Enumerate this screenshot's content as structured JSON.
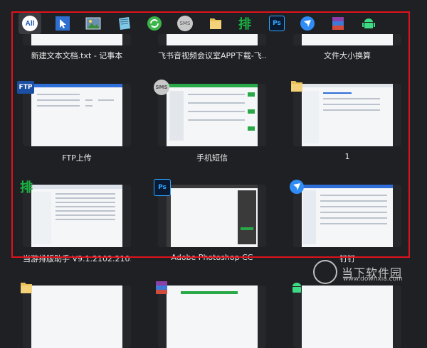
{
  "filter_bar": {
    "items": [
      {
        "name": "all",
        "label": "All"
      },
      {
        "name": "cursor",
        "label": ""
      },
      {
        "name": "photo-viewer",
        "label": ""
      },
      {
        "name": "notepad",
        "label": ""
      },
      {
        "name": "refresh",
        "label": ""
      },
      {
        "name": "sms",
        "label": "SMS"
      },
      {
        "name": "folder",
        "label": ""
      },
      {
        "name": "paiban",
        "label": "排"
      },
      {
        "name": "photoshop",
        "label": "Ps"
      },
      {
        "name": "dingtalk",
        "label": ""
      },
      {
        "name": "winrar",
        "label": ""
      },
      {
        "name": "android",
        "label": ""
      }
    ]
  },
  "windows": [
    {
      "caption": "新建文本文档.txt - 记事本"
    },
    {
      "caption": "飞书音视频会议室APP下载-飞..."
    },
    {
      "caption": "文件大小换算"
    },
    {
      "caption": "FTP上传",
      "badge": "FTP"
    },
    {
      "caption": "手机短信",
      "badge": "SMS"
    },
    {
      "caption": "1"
    },
    {
      "caption": "当游排版助手 V9.1.2102.210...",
      "badge": "排"
    },
    {
      "caption": "Adobe Photoshop CC",
      "badge": "Ps"
    },
    {
      "caption": "钉钉"
    }
  ],
  "watermark": {
    "text": "当下软件园",
    "url": "www.downxia.com"
  },
  "colors": {
    "highlight_border": "#e0121b",
    "background": "#1f2024"
  }
}
